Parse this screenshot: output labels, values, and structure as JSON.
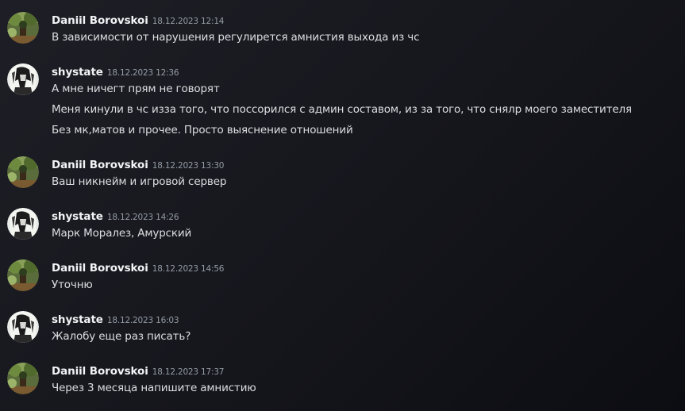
{
  "messages": [
    {
      "author": "Daniil Borovskoi",
      "avatar_icon": "forest-avatar-icon",
      "timestamp": "18.12.2023 12:14",
      "lines": [
        "В зависимости от нарушения регулирется амнистия выхода из чс"
      ]
    },
    {
      "author": "shystate",
      "avatar_icon": "anime-avatar-icon",
      "timestamp": "18.12.2023 12:36",
      "lines": [
        "А мне ничегт прям не говорят",
        "Меня кинули в чс изза того, что поссорился с админ составом, из за того, что снялр моего заместителя",
        "Без мк,матов и прочее. Просто выяснение отношений"
      ]
    },
    {
      "author": "Daniil Borovskoi",
      "avatar_icon": "forest-avatar-icon",
      "timestamp": "18.12.2023 13:30",
      "lines": [
        "Ваш никнейм и игровой сервер"
      ]
    },
    {
      "author": "shystate",
      "avatar_icon": "anime-avatar-icon",
      "timestamp": "18.12.2023 14:26",
      "lines": [
        "Марк Моралез, Амурский"
      ]
    },
    {
      "author": "Daniil Borovskoi",
      "avatar_icon": "forest-avatar-icon",
      "timestamp": "18.12.2023 14:56",
      "lines": [
        "Уточню"
      ]
    },
    {
      "author": "shystate",
      "avatar_icon": "anime-avatar-icon",
      "timestamp": "18.12.2023 16:03",
      "lines": [
        "Жалобу еще раз писать?"
      ]
    },
    {
      "author": "Daniil Borovskoi",
      "avatar_icon": "forest-avatar-icon",
      "timestamp": "18.12.2023 17:37",
      "lines": [
        "Через 3 месяца напишите амнистию"
      ]
    }
  ],
  "colors": {
    "author": "#f2f3f5",
    "timestamp": "#949ba4",
    "message_text": "#dbdee1",
    "background": "#1a1b22"
  }
}
